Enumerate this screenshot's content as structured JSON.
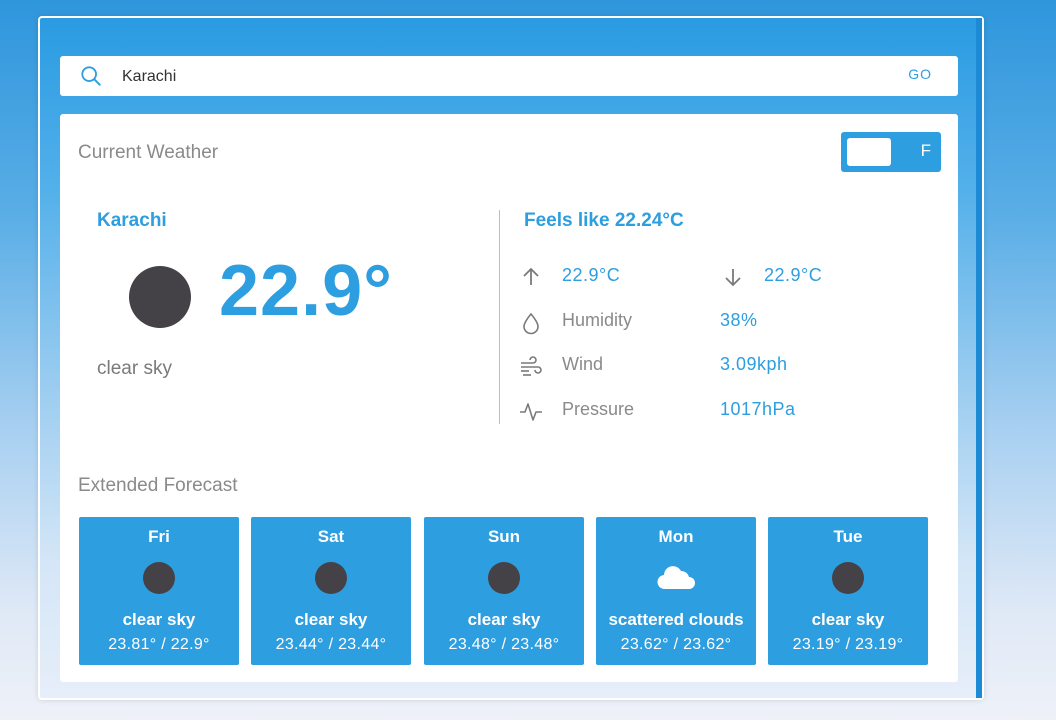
{
  "search": {
    "value": "Karachi",
    "go_label": "GO"
  },
  "current": {
    "title": "Current Weather",
    "unit_toggle": "F",
    "city": "Karachi",
    "temp": "22.9°",
    "description": "clear sky",
    "icon": "sun-icon",
    "feels_like": "Feels like 22.24°C",
    "high": "22.9°C",
    "low": "22.9°C",
    "humidity_label": "Humidity",
    "humidity": "38%",
    "wind_label": "Wind",
    "wind": "3.09kph",
    "pressure_label": "Pressure",
    "pressure": "1017hPa"
  },
  "forecast": {
    "title": "Extended Forecast",
    "days": [
      {
        "day": "Fri",
        "desc": "clear sky",
        "range": "23.81° / 22.9°",
        "icon": "sun-icon"
      },
      {
        "day": "Sat",
        "desc": "clear sky",
        "range": "23.44° / 23.44°",
        "icon": "sun-icon"
      },
      {
        "day": "Sun",
        "desc": "clear sky",
        "range": "23.48° / 23.48°",
        "icon": "sun-icon"
      },
      {
        "day": "Mon",
        "desc": "scattered clouds",
        "range": "23.62° / 23.62°",
        "icon": "cloud-icon"
      },
      {
        "day": "Tue",
        "desc": "clear sky",
        "range": "23.19° / 23.19°",
        "icon": "sun-icon"
      }
    ]
  },
  "colors": {
    "accent": "#2d9ee0",
    "muted_text": "#8a8a8a",
    "icon_dark": "#444246"
  }
}
